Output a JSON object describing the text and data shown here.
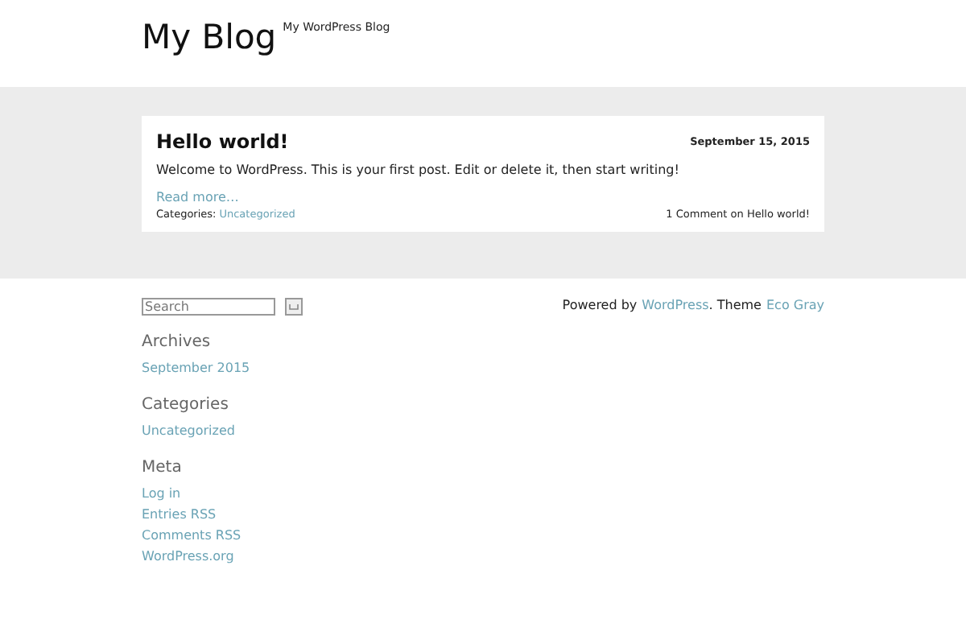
{
  "site": {
    "title": "My Blog",
    "tagline": "My WordPress Blog"
  },
  "post": {
    "title": "Hello world!",
    "date": "September 15, 2015",
    "excerpt": "Welcome to WordPress. This is your first post. Edit or delete it, then start writing!",
    "read_more": "Read more…",
    "categories_label": "Categories:",
    "category": "Uncategorized",
    "comments": "1 Comment on Hello world!"
  },
  "search": {
    "placeholder": "Search"
  },
  "widgets": [
    {
      "title": "Archives",
      "links": [
        "September 2015"
      ]
    },
    {
      "title": "Categories",
      "links": [
        "Uncategorized"
      ]
    },
    {
      "title": "Meta",
      "links": [
        "Log in",
        "Entries RSS",
        "Comments RSS",
        "WordPress.org"
      ]
    }
  ],
  "footer": {
    "prefix": "Powered by",
    "link1": "WordPress",
    "middle": ". Theme",
    "link2": "Eco Gray"
  }
}
